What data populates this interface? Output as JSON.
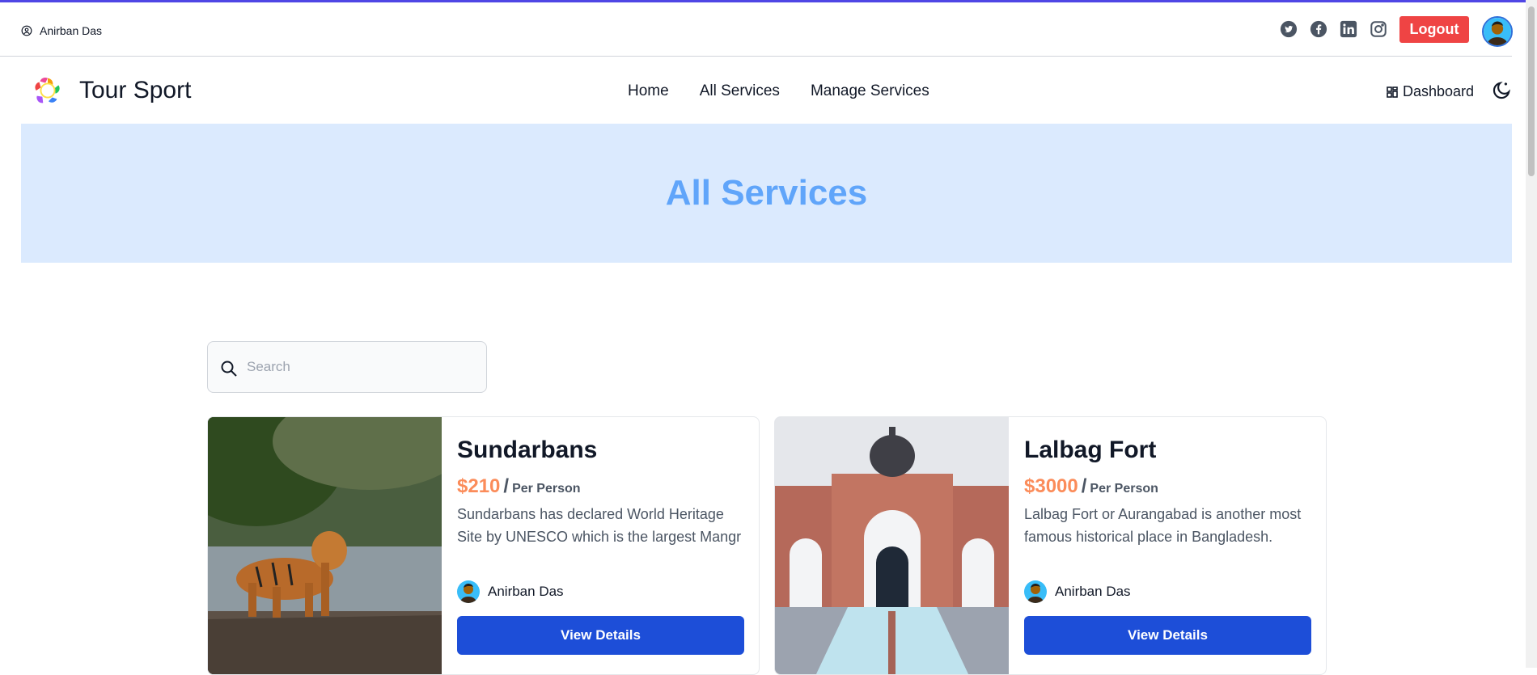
{
  "topbar": {
    "user_name": "Anirban Das",
    "socials": [
      "twitter-icon",
      "facebook-icon",
      "linkedin-icon",
      "instagram-icon"
    ],
    "logout_label": "Logout"
  },
  "nav": {
    "brand_name": "Tour Sport",
    "links": [
      "Home",
      "All Services",
      "Manage Services"
    ],
    "dashboard_label": "Dashboard"
  },
  "banner": {
    "title": "All Services"
  },
  "search": {
    "placeholder": "Search",
    "value": ""
  },
  "cards": [
    {
      "title": "Sundarbans",
      "price": "$210",
      "slash": "/",
      "per": "Per Person",
      "description": "Sundarbans has declared World Heritage Site by UNESCO which is the largest Mangr",
      "author": "Anirban Das",
      "button": "View Details"
    },
    {
      "title": "Lalbag Fort",
      "price": "$3000",
      "slash": "/",
      "per": "Per Person",
      "description": "Lalbag Fort or Aurangabad is another most famous historical place in Bangladesh.",
      "author": "Anirban Das",
      "button": "View Details"
    }
  ],
  "colors": {
    "accent": "#1d4ed8",
    "logout": "#ef4444",
    "price": "#fb8c5a",
    "banner_bg": "#dbeafe",
    "banner_text": "#60a5fa"
  }
}
